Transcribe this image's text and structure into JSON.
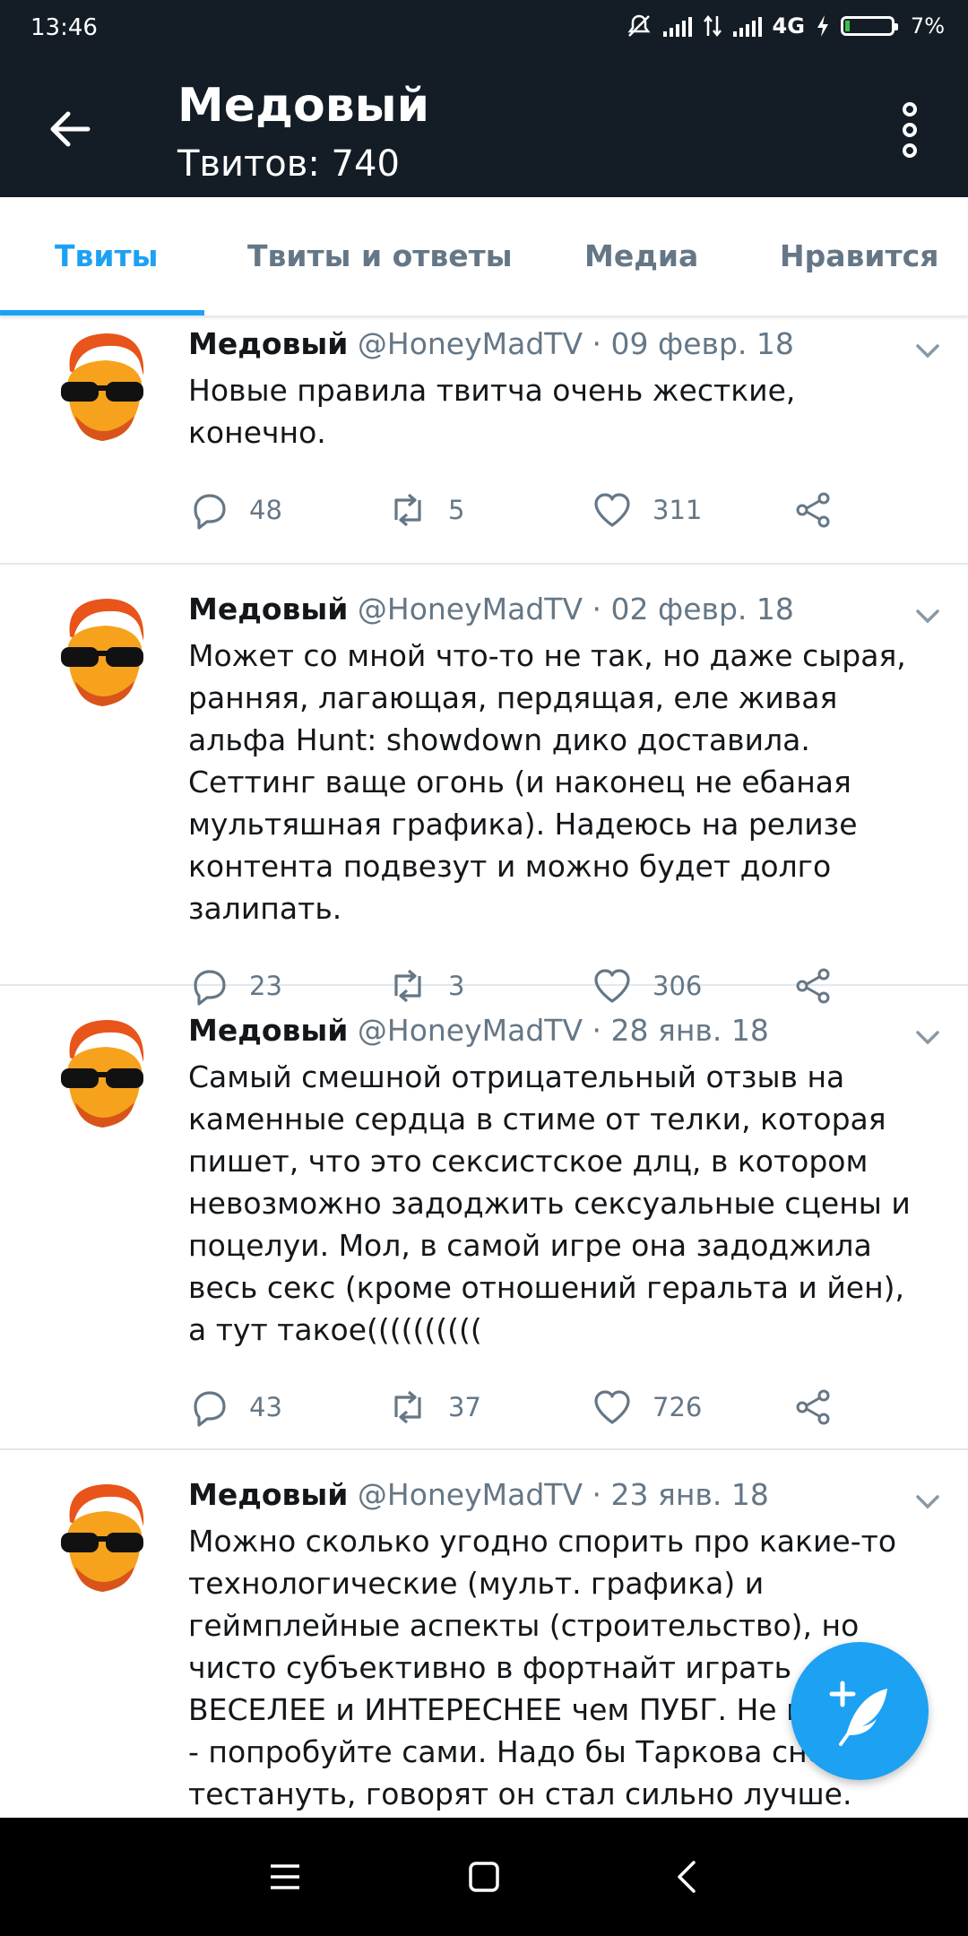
{
  "status_bar": {
    "time": "13:46",
    "network": "4G",
    "battery": "7%"
  },
  "header": {
    "title": "Медовый",
    "subtitle": "Твитов: 740"
  },
  "tabs": [
    {
      "label": "Твиты",
      "active": true
    },
    {
      "label": "Твиты и ответы",
      "active": false
    },
    {
      "label": "Медиа",
      "active": false
    },
    {
      "label": "Нравится",
      "active": false
    }
  ],
  "tweets": [
    {
      "name": "Медовый",
      "handle": "@HoneyMadTV",
      "date": "· 09 февр. 18",
      "text": "Новые правила твитча очень жесткие, конечно.",
      "replies": "48",
      "retweets": "5",
      "likes": "311"
    },
    {
      "name": "Медовый",
      "handle": "@HoneyMadTV",
      "date": "· 02 февр. 18",
      "text": "Может со мной что-то не так, но даже сырая, ранняя, лагающая, пердящая, еле живая альфа Hunt: showdown дико доставила. Сеттинг ваще огонь (и наконец не ебаная мультяшная графика). Надеюсь на релизе контента подвезут и можно будет долго залипать.",
      "replies": "23",
      "retweets": "3",
      "likes": "306"
    },
    {
      "name": "Медовый",
      "handle": "@HoneyMadTV",
      "date": "· 28 янв. 18",
      "text": "Самый смешной отрицательный отзыв на каменные сердца в стиме от телки, которая пишет, что это сексистское длц, в котором невозможно задоджить сексуальные сцены и поцелуи. Мол, в самой игре она задоджила весь секс (кроме отношений геральта и йен), а тут такое((((((((((",
      "replies": "43",
      "retweets": "37",
      "likes": "726"
    },
    {
      "name": "Медовый",
      "handle": "@HoneyMadTV",
      "date": "· 23 янв. 18",
      "text": "Можно сколько угодно спорить про какие-то технологические (мульт. графика) и геймплейные аспекты (строительство), но чисто субъективно в фортнайт играть ВЕСЕЛЕЕ и ИНТЕРЕСНЕЕ чем ПУБГ. Не верите - попробуйте сами. Надо бы Таркова снова тестануть, говорят он стал сильно лучше.",
      "replies": "",
      "retweets": "",
      "likes": ""
    }
  ],
  "colors": {
    "accent": "#1da1f2",
    "header_bg": "#141d26",
    "muted": "#657786"
  }
}
